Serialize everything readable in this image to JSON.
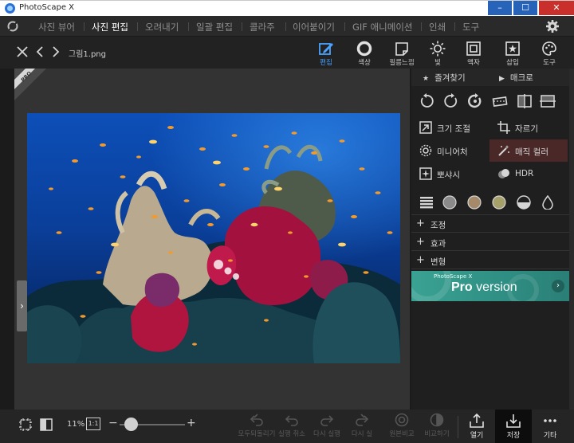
{
  "window": {
    "title": "PhotoScape X",
    "min": "–",
    "max": "☐",
    "close": "✕"
  },
  "menu": {
    "items": [
      {
        "label": "사진 뷰어",
        "active": false
      },
      {
        "label": "사진 편집",
        "active": true
      },
      {
        "label": "오려내기",
        "active": false
      },
      {
        "label": "일괄 편집",
        "active": false
      },
      {
        "label": "콜라주",
        "active": false
      },
      {
        "label": "이어붙이기",
        "active": false
      },
      {
        "label": "GIF 애니메이션",
        "active": false
      },
      {
        "label": "인쇄",
        "active": false
      },
      {
        "label": "도구",
        "active": false
      }
    ]
  },
  "toolbar": {
    "filename": "그림1.png",
    "tools": [
      {
        "label": "편집",
        "icon": "edit-icon",
        "active": true
      },
      {
        "label": "색상",
        "icon": "color-circle-icon",
        "active": false
      },
      {
        "label": "필름느낌",
        "icon": "film-icon",
        "active": false
      },
      {
        "label": "빛",
        "icon": "sun-icon",
        "active": false
      },
      {
        "label": "액자",
        "icon": "frame-icon",
        "active": false
      },
      {
        "label": "삽입",
        "icon": "insert-icon",
        "active": false
      },
      {
        "label": "도구",
        "icon": "palette-icon",
        "active": false
      }
    ]
  },
  "canvas": {
    "badge": "PRO"
  },
  "panel": {
    "favorites": "즐겨찾기",
    "macro": "매크로",
    "functions": [
      {
        "label": "크기 조절",
        "icon": "resize-icon"
      },
      {
        "label": "자르기",
        "icon": "crop-icon"
      },
      {
        "label": "미니어처",
        "icon": "miniature-icon"
      },
      {
        "label": "매직 컬러",
        "icon": "magic-color-icon"
      },
      {
        "label": "뽀샤시",
        "icon": "bloom-icon"
      },
      {
        "label": "HDR",
        "icon": "hdr-icon"
      }
    ],
    "sections": [
      "조정",
      "효과",
      "변형"
    ],
    "promo": {
      "small": "PhotoScape X",
      "bold": "Pro",
      "rest": " version",
      "arrow": "›"
    }
  },
  "bottom": {
    "zoom": "11%",
    "one_to_one": "1:1",
    "minus": "−",
    "plus": "+",
    "zoom_level": 0.08,
    "history": [
      {
        "label": "모두되돌리기",
        "icon": "revert-all-icon"
      },
      {
        "label": "실행 취소",
        "icon": "undo-icon"
      },
      {
        "label": "다시 실행",
        "icon": "redo-icon"
      },
      {
        "label": "다시 실",
        "icon": "redo-all-icon"
      },
      {
        "label": "원본비교",
        "icon": "compare-original-icon"
      },
      {
        "label": "비교하기",
        "icon": "compare-icon"
      }
    ],
    "actions": [
      {
        "label": "열기",
        "icon": "open-icon"
      },
      {
        "label": "저장",
        "icon": "save-icon"
      },
      {
        "label": "기타",
        "icon": "more-icon"
      }
    ]
  },
  "colors": {
    "accent": "#4aa3ff",
    "promo": "#35998c",
    "close": "#c9302c"
  }
}
